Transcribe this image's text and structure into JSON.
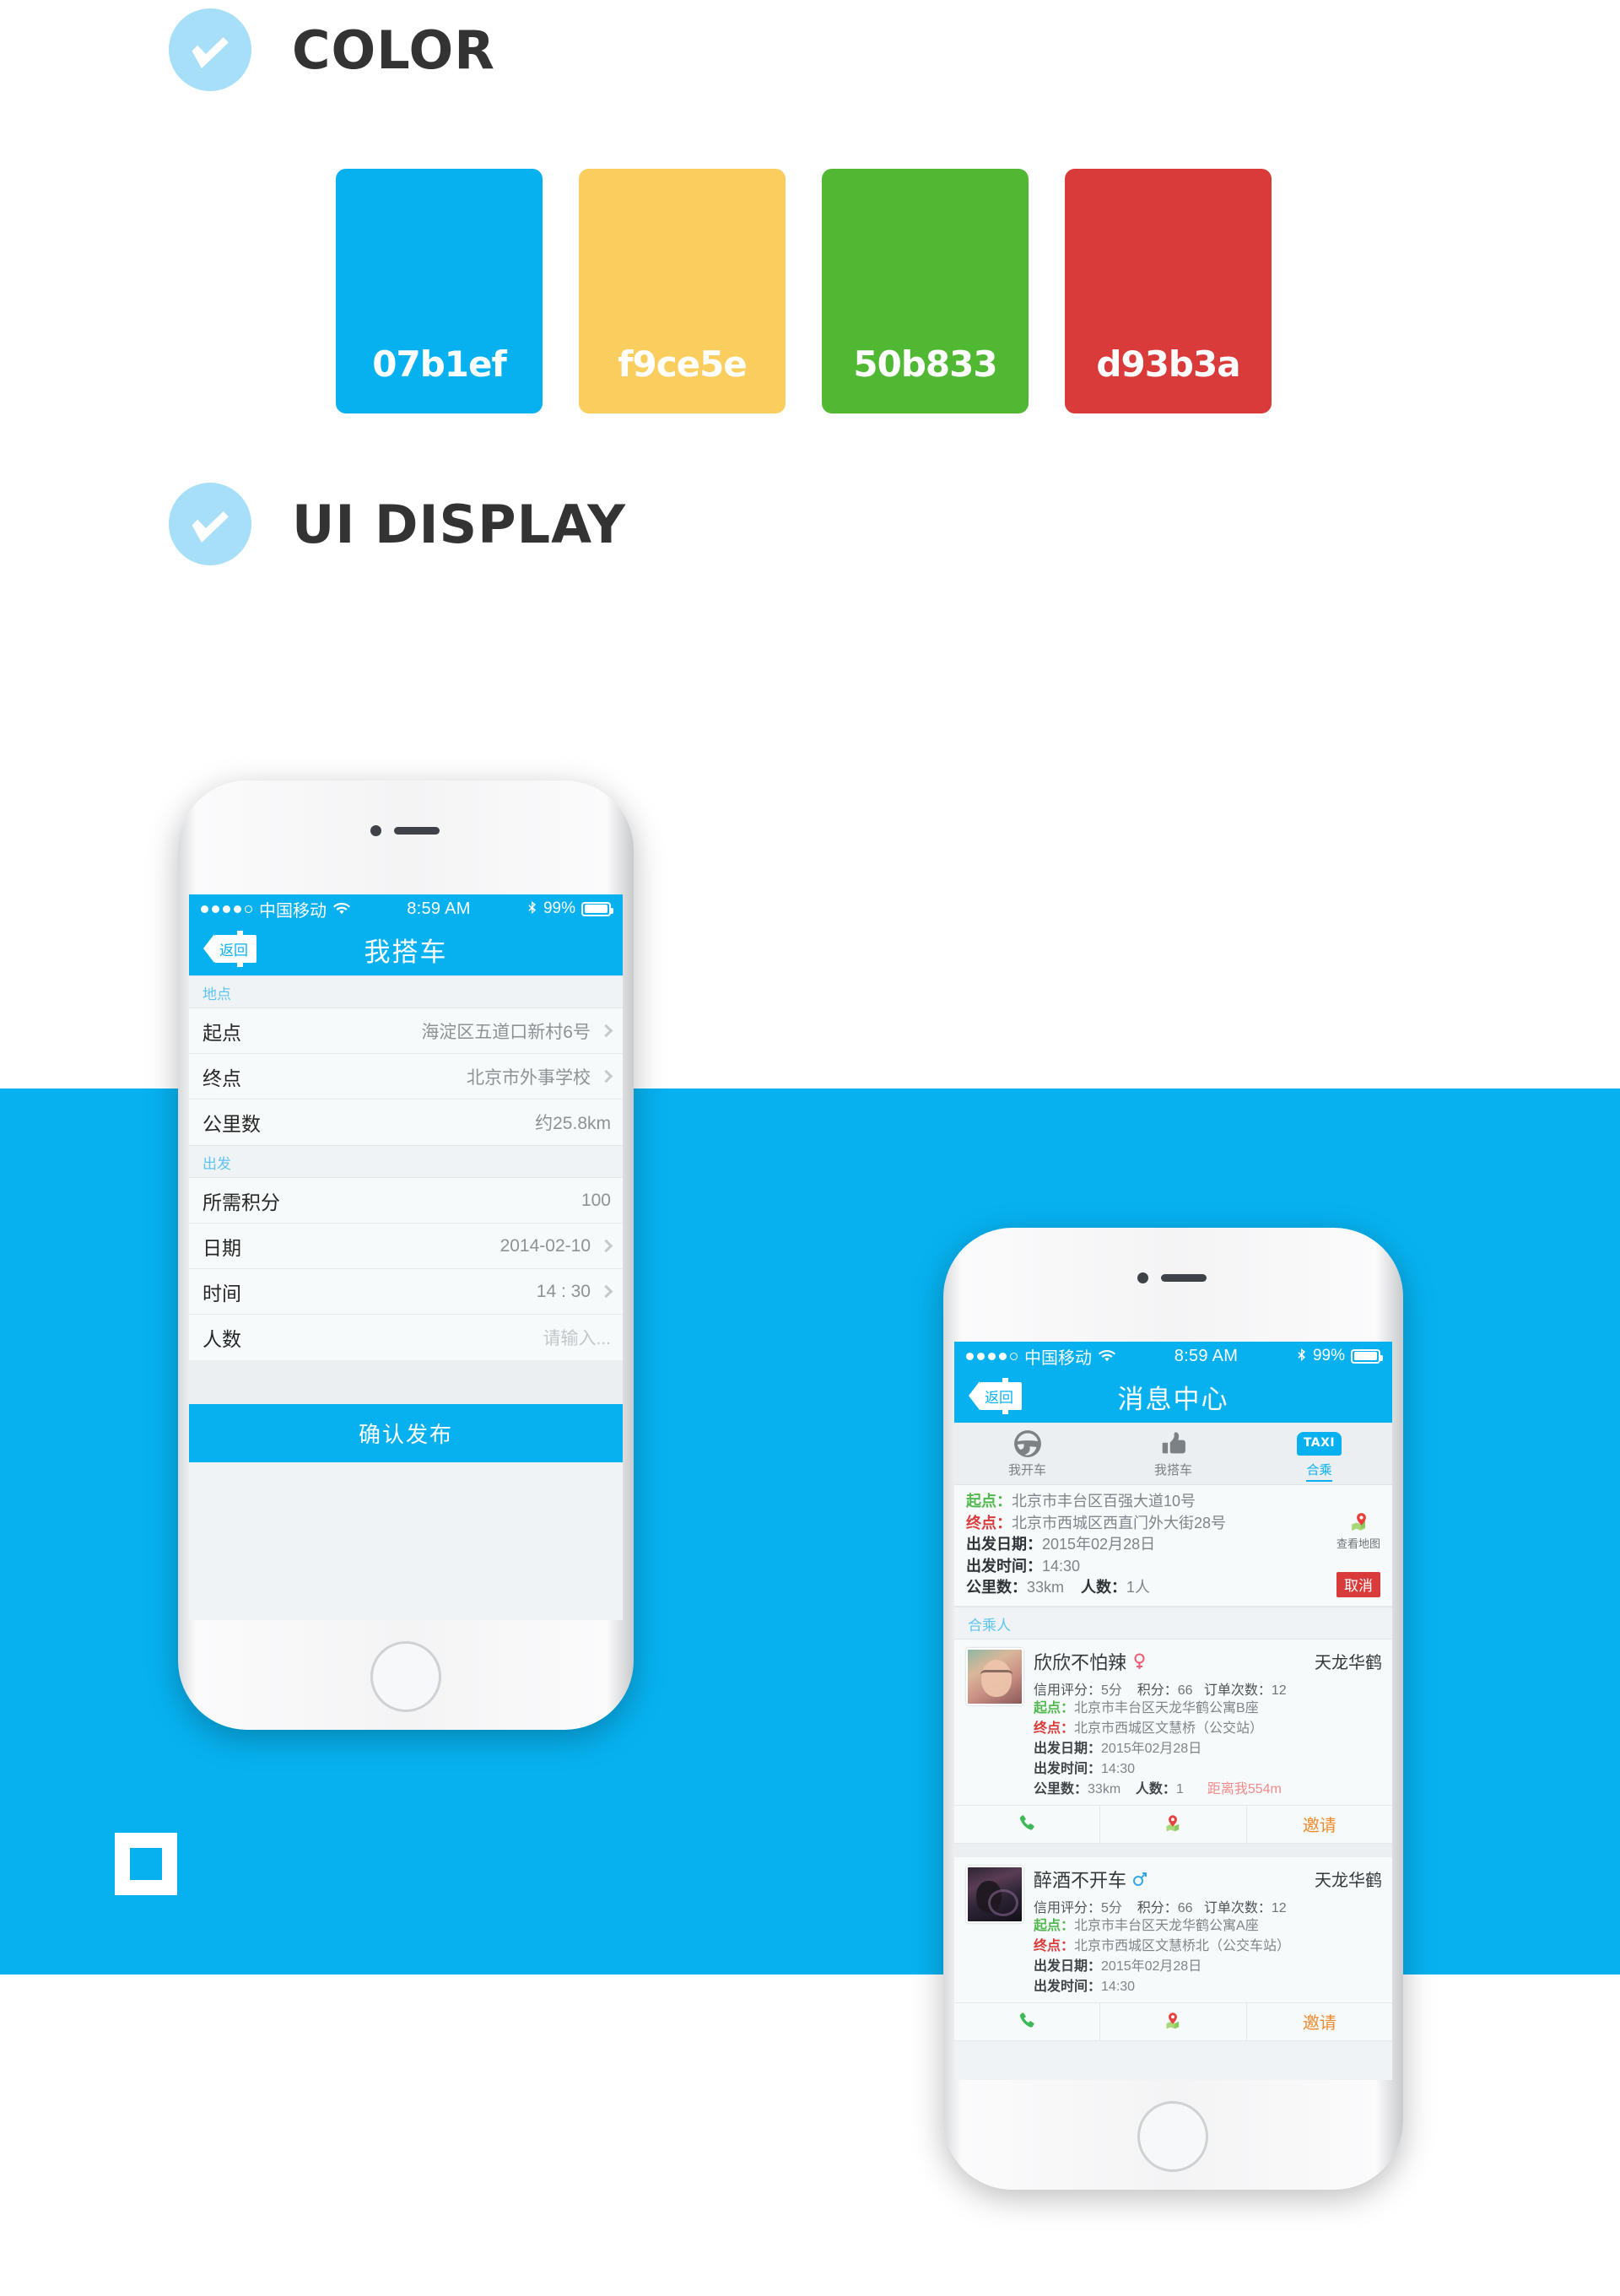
{
  "sections": {
    "color_heading": "COLOR",
    "ui_heading": "UI DISPLAY",
    "check_icon": "check-icon",
    "logo_icon": "square-outline-logo"
  },
  "palette": [
    {
      "hex": "#07b1ef",
      "label": "07b1ef"
    },
    {
      "hex": "#f9ce5e",
      "label": "f9ce5e"
    },
    {
      "hex": "#50b833",
      "label": "50b833"
    },
    {
      "hex": "#d93b3a",
      "label": "d93b3a"
    }
  ],
  "accent": {
    "brand_blue": "#07b1ef",
    "light_blue": "#a6dff7",
    "yellow": "#f9ce5e",
    "green": "#50b833",
    "red": "#d93b3a",
    "orange": "#f08a2e",
    "start_green": "#52b94e",
    "end_red": "#d93b3a",
    "distance_pink": "#f08a8a"
  },
  "status_bar": {
    "carrier": "中国移动",
    "time": "8:59 AM",
    "battery": "99%",
    "signal_icon": "signal-dots-icon",
    "wifi_icon": "wifi-icon",
    "bluetooth_icon": "bluetooth-icon",
    "battery_icon": "battery-icon"
  },
  "phone1": {
    "nav": {
      "back": "返回",
      "title": "我搭车",
      "back_icon": "back-tag-icon"
    },
    "groups": [
      {
        "header": "地点",
        "rows": [
          {
            "label": "起点",
            "value": "海淀区五道口新村6号",
            "chevron": true
          },
          {
            "label": "终点",
            "value": "北京市外事学校",
            "chevron": true
          },
          {
            "label": "公里数",
            "value": "约25.8km",
            "chevron": false
          }
        ]
      },
      {
        "header": "出发",
        "rows": [
          {
            "label": "所需积分",
            "value": "100",
            "chevron": false
          },
          {
            "label": "日期",
            "value": "2014-02-10",
            "chevron": true
          },
          {
            "label": "时间",
            "value": "14 : 30",
            "chevron": true
          },
          {
            "label": "人数",
            "value": "请输入...",
            "chevron": false,
            "placeholder": true
          }
        ]
      }
    ],
    "submit": "确认发布"
  },
  "phone2": {
    "nav": {
      "back": "返回",
      "title": "消息中心",
      "back_icon": "back-tag-icon"
    },
    "tabs": [
      {
        "label": "我开车",
        "icon": "steering-wheel-icon",
        "active": false
      },
      {
        "label": "我搭车",
        "icon": "thumbs-up-icon",
        "active": false
      },
      {
        "label": "合乘",
        "icon": "taxi-badge-icon",
        "badge": "TAXI",
        "active": true
      }
    ],
    "trip": {
      "start_label": "起点：",
      "start_value": "北京市丰台区百强大道10号",
      "end_label": "终点：",
      "end_value": "北京市西城区西直门外大街28号",
      "date_label": "出发日期：",
      "date_value": "2015年02月28日",
      "time_label": "出发时间：",
      "time_value": "14:30",
      "km_label": "公里数：",
      "km_value": "33km",
      "people_label": "人数：",
      "people_value": "1人",
      "map_link": "查看地图",
      "map_icon": "map-pin-icon",
      "cancel": "取消"
    },
    "passengers_header": "合乘人",
    "passengers": [
      {
        "name": "欣欣不怕辣",
        "gender": "female",
        "gender_icon": "female-icon",
        "place": "天龙华鹤",
        "avatar": "avatar-photo-woman",
        "credit_label": "信用评分：",
        "credit_value": "5分",
        "points_label": "积分：",
        "points_value": "66",
        "orders_label": "订单次数：",
        "orders_value": "12",
        "start_label": "起点：",
        "start_value": "北京市丰台区天龙华鹤公寓B座",
        "end_label": "终点：",
        "end_value": "北京市西城区文慧桥（公交站）",
        "date_label": "出发日期：",
        "date_value": "2015年02月28日",
        "time_label": "出发时间：",
        "time_value": "14:30",
        "km_label": "公里数：",
        "km_value": "33km",
        "people_label": "人数：",
        "people_value": "1",
        "distance": "距离我554m",
        "show_km_row": true,
        "actions": [
          {
            "name": "call",
            "icon": "phone-icon",
            "label": ""
          },
          {
            "name": "locate",
            "icon": "map-pin-icon",
            "label": ""
          },
          {
            "name": "invite",
            "icon": "",
            "label": "邀请"
          }
        ]
      },
      {
        "name": "醉酒不开车",
        "gender": "male",
        "gender_icon": "male-icon",
        "place": "天龙华鹤",
        "avatar": "avatar-photo-man-driving",
        "credit_label": "信用评分：",
        "credit_value": "5分",
        "points_label": "积分：",
        "points_value": "66",
        "orders_label": "订单次数：",
        "orders_value": "12",
        "start_label": "起点：",
        "start_value": "北京市丰台区天龙华鹤公寓A座",
        "end_label": "终点：",
        "end_value": "北京市西城区文慧桥北（公交车站）",
        "date_label": "出发日期：",
        "date_value": "2015年02月28日",
        "time_label": "出发时间：",
        "time_value": "14:30",
        "km_label": "",
        "km_value": "",
        "people_label": "",
        "people_value": "",
        "distance": "",
        "show_km_row": false,
        "actions": [
          {
            "name": "call",
            "icon": "phone-icon",
            "label": ""
          },
          {
            "name": "locate",
            "icon": "map-pin-icon",
            "label": ""
          },
          {
            "name": "invite",
            "icon": "",
            "label": "邀请"
          }
        ]
      }
    ]
  }
}
